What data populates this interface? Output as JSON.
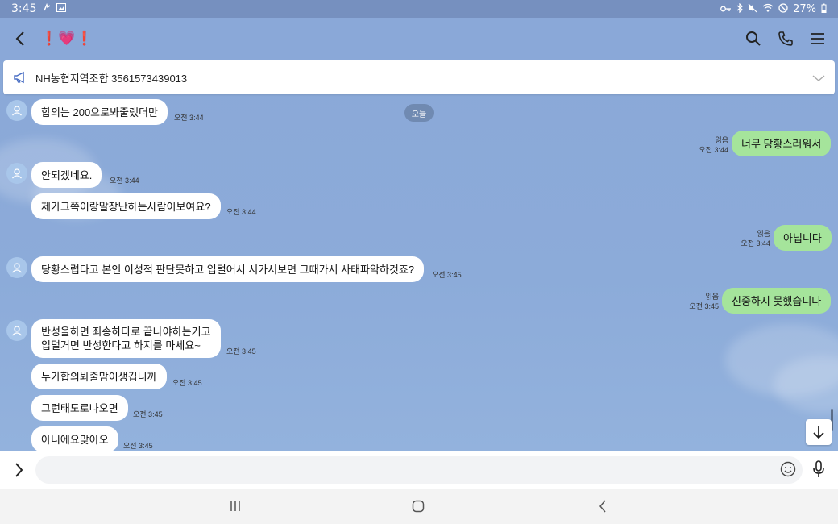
{
  "status_bar": {
    "time": "3:45",
    "battery": "27%"
  },
  "header": {
    "title": "❗💗❗"
  },
  "notice": {
    "text": "NH농협지역조합 3561573439013"
  },
  "date_chip": "오늘",
  "messages": [
    {
      "side": "left",
      "avatar": true,
      "text": "합의는 200으로봐줄랬더만",
      "time": "오전 3:44"
    },
    {
      "side": "right",
      "text": "너무 당황스러워서",
      "read": "읽음",
      "time": "오전 3:44"
    },
    {
      "side": "left",
      "avatar": true,
      "text": "안되겠네요.",
      "time": "오전 3:44"
    },
    {
      "side": "left",
      "avatar": false,
      "text": "제가그쪽이랑말장난하는사람이보여요?",
      "time": "오전 3:44"
    },
    {
      "side": "right",
      "text": "아닙니다",
      "read": "읽음",
      "time": "오전 3:44"
    },
    {
      "side": "left",
      "avatar": true,
      "text": "당황스럽다고 본인 이성적 판단못하고 입털어서 서가서보면 그때가서 사태파악하것죠?",
      "time": "오전 3:45"
    },
    {
      "side": "right",
      "text": "신중하지 못했습니다",
      "read": "읽음",
      "time": "오전 3:45"
    },
    {
      "side": "left",
      "avatar": true,
      "lines": [
        "반성을하면 죄송하다로 끝나야하는거고",
        "입털거면 반성한다고 하지를 마세요~"
      ],
      "time": "오전 3:45"
    },
    {
      "side": "left",
      "avatar": false,
      "text": "누가합의봐줄맘이생깁니까",
      "time": "오전 3:45"
    },
    {
      "side": "left",
      "avatar": false,
      "text": "그런태도로나오면",
      "time": "오전 3:45"
    },
    {
      "side": "left",
      "avatar": false,
      "text": "아니에요맞아오",
      "time": "오전 3:45"
    }
  ],
  "input": {
    "placeholder": ""
  },
  "icons": {
    "back": "chevron-left-icon",
    "search": "search-icon",
    "call": "phone-icon",
    "menu": "hamburger-menu-icon",
    "notice": "megaphone-icon",
    "notice_expand": "chevron-down-icon",
    "scroll_down": "arrow-down-icon",
    "expand": "chevron-right-icon",
    "emoji": "smiley-icon",
    "mic": "microphone-icon"
  },
  "colors": {
    "chat_background": "#8aaad8",
    "my_bubble": "#a5e49b",
    "other_bubble": "#ffffff",
    "status_bar": "#7690bf"
  }
}
